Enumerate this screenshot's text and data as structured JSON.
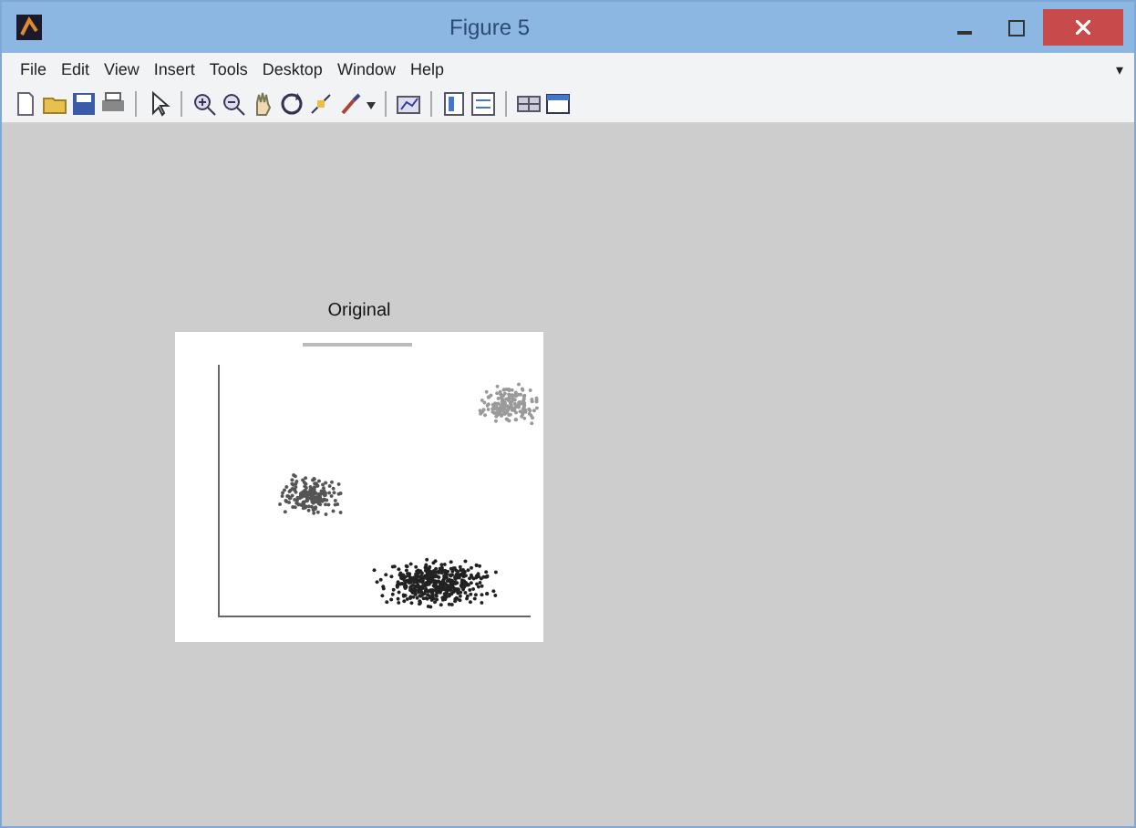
{
  "window": {
    "title": "Figure 5"
  },
  "menu": [
    "File",
    "Edit",
    "View",
    "Insert",
    "Tools",
    "Desktop",
    "Window",
    "Help"
  ],
  "menu_overflow": "▾",
  "figure": {
    "title": "Original"
  }
}
